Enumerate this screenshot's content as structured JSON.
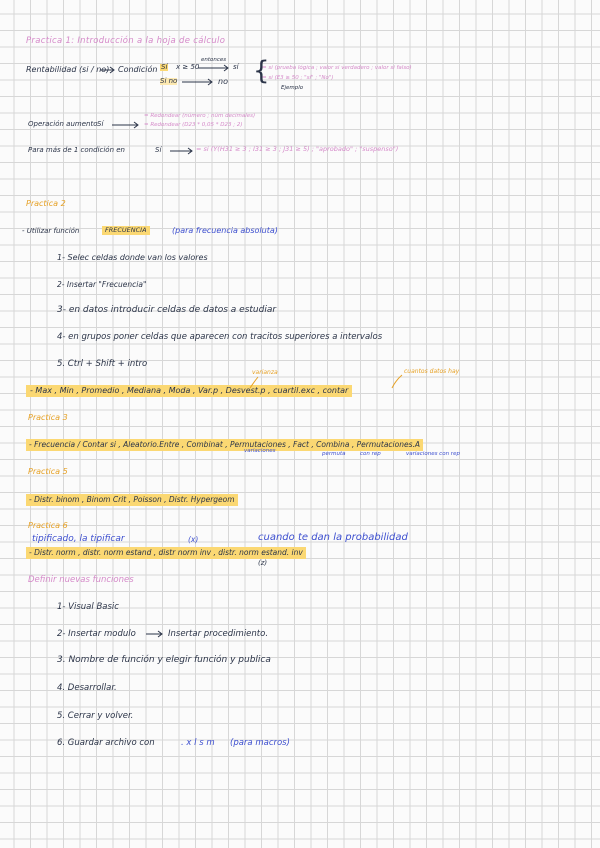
{
  "header": {
    "title": "Practica 1: Introducción a la hoja de cálculo"
  },
  "section1": {
    "rentabilidad_label": "Rentabilidad (si / no)",
    "condicion": "Condición",
    "si": "Sí",
    "no": "Si no",
    "cond_expr": "x ≥ 50",
    "entonces": "entonces",
    "res_si": "sí",
    "res_no": "no",
    "note_1": "= si (prueba lógica ; valor si verdadero ; valor si falso)",
    "note_2": "= si (E3 ≥ 50 ; \"sí\" ; \"No\")",
    "ejemplo": "Ejemplo",
    "operacion_label": "Operación aumento",
    "op_si": "Sí",
    "redondear_1": "= Redondear (número ; núm decimales)",
    "redondear_2": "= Redondear (D23 * 0,05 * D23 ; 2)",
    "mas_label": "Para más de 1 condición en",
    "mas_si": "Sí",
    "mas_expr": "= si (Y(H31 ≥ 3 ; I31 ≥ 3 ; J31 ≥ 5) ; \"aprobado\" ; \"suspenso\")"
  },
  "practica2": {
    "title": "Practica 2",
    "intro": "- Utilizar función",
    "frecuencia": "FRECUENCIA",
    "paren_note": "(para frecuencia absoluta)",
    "steps": [
      "1- Selec celdas donde van los valores",
      "2- Insertar \"Frecuencia\"",
      "3- en datos introducir celdas de datos a estudiar",
      "4- en grupos poner celdas que aparecen con tracitos superiores a intervalos",
      "5. Ctrl + Shift + intro"
    ],
    "functions_line": "- Max , Min , Promedio , Mediana , Moda , Var.p , Desvest.p , cuartil.exc , contar",
    "varianza_note": "varianza",
    "cuantos_note": "cuantos datos hay"
  },
  "practica3": {
    "title": "Practica 3",
    "line": "- Frecuencia / Contar si , Aleatorio.Entre , Combinat , Permutaciones , Fact , Combina , Permutaciones.A",
    "notes": [
      "variaciones",
      "permuta",
      "con rep",
      "variaciones con rep"
    ]
  },
  "practica5": {
    "title": "Practica 5",
    "line": "- Distr. binom , Binom Crit , Poisson , Distr. Hypergeom"
  },
  "practica6": {
    "title": "Practica 6",
    "blue_line": "tipificado, la tipificar",
    "x_paren": "(x)",
    "cuando": "cuando te dan la probabilidad",
    "line": "- Distr. norm , distr. norm estand , distr norm inv , distr. norm estand. inv",
    "z_paren": "(z)"
  },
  "definir": {
    "title": "Definir nuevas funciones",
    "steps": [
      "1- Visual Basic",
      "2- Insertar modulo",
      "Insertar procedimiento.",
      "3. Nombre de función y elegir función y publica",
      "4. Desarrollar.",
      "5. Cerrar y volver.",
      "6. Guardar archivo con",
      ". x l s m",
      "(para macros)"
    ]
  }
}
